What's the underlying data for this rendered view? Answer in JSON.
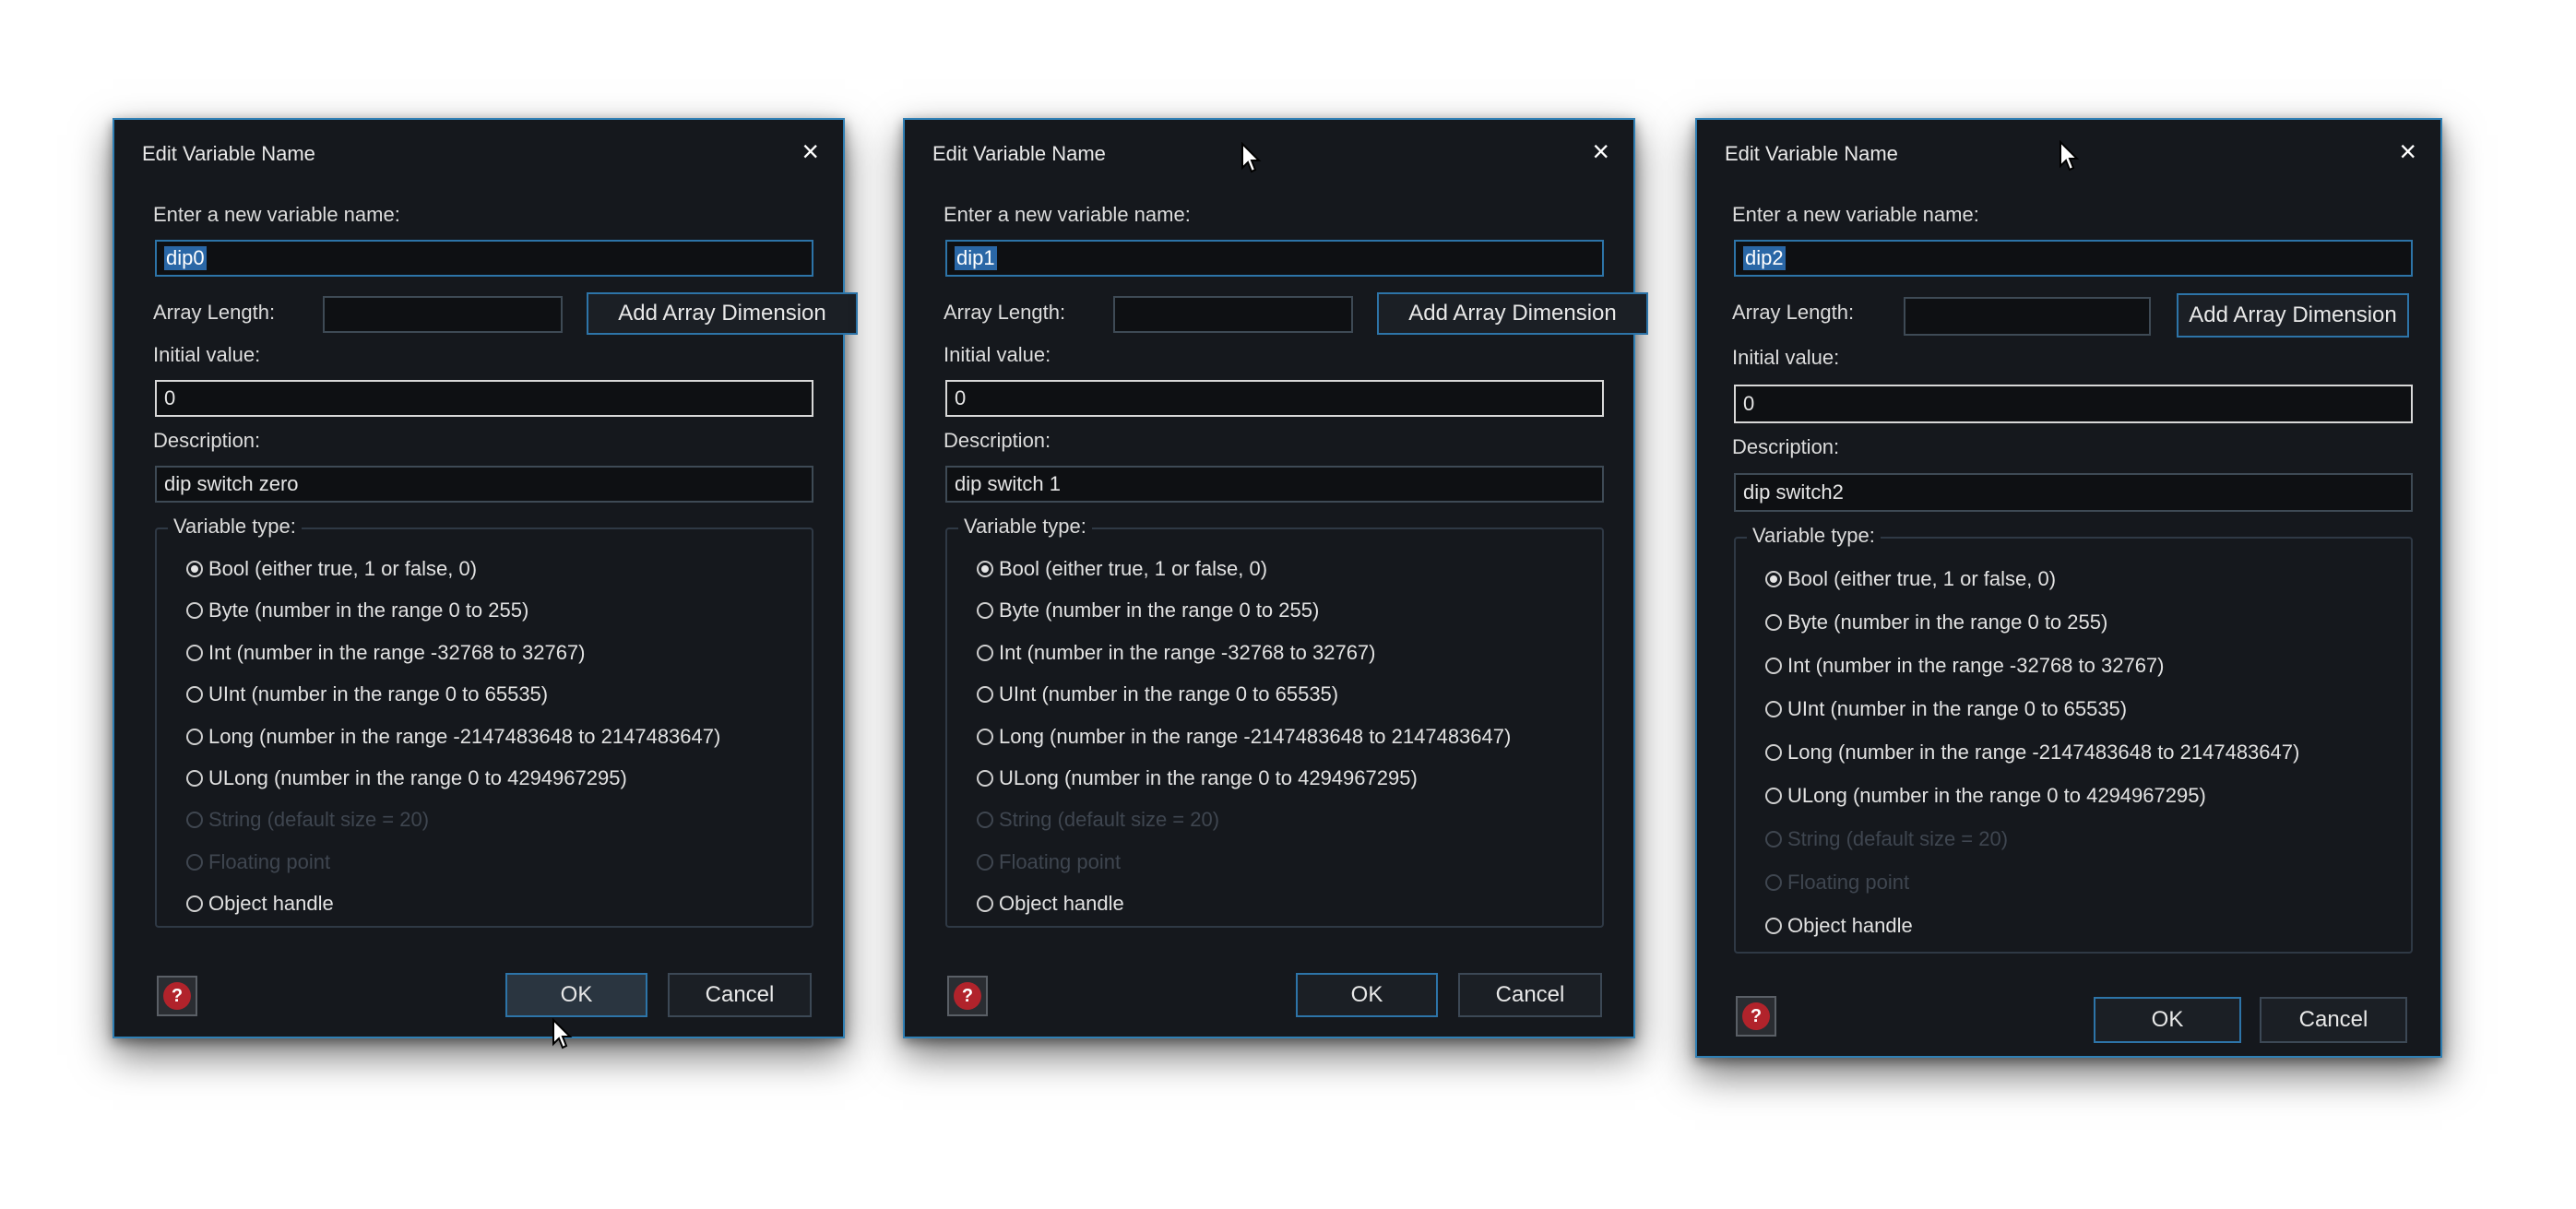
{
  "dialogs": [
    {
      "title": "Edit Variable Name",
      "name_label": "Enter a new variable name:",
      "name_value": "dip0",
      "array_length_label": "Array Length:",
      "array_length_value": "",
      "add_array_dimension_label": "Add Array Dimension",
      "initial_value_label": "Initial value:",
      "initial_value": "0",
      "description_label": "Description:",
      "description_value": "dip switch zero",
      "variable_type_label": "Variable type:",
      "selected_type": "Bool",
      "types": [
        {
          "label": "Bool (either true, 1 or false, 0)",
          "enabled": true,
          "checked": true
        },
        {
          "label": "Byte (number in the range 0 to 255)",
          "enabled": true,
          "checked": false
        },
        {
          "label": "Int (number in the range -32768 to 32767)",
          "enabled": true,
          "checked": false
        },
        {
          "label": "UInt (number in the range 0 to 65535)",
          "enabled": true,
          "checked": false
        },
        {
          "label": "Long (number in the range -2147483648 to 2147483647)",
          "enabled": true,
          "checked": false
        },
        {
          "label": "ULong (number in the range 0 to 4294967295)",
          "enabled": true,
          "checked": false
        },
        {
          "label": "String (default size = 20)",
          "enabled": false,
          "checked": false
        },
        {
          "label": "Floating point",
          "enabled": false,
          "checked": false
        },
        {
          "label": "Object handle",
          "enabled": true,
          "checked": false
        }
      ],
      "ok_label": "OK",
      "cancel_label": "Cancel"
    },
    {
      "title": "Edit Variable Name",
      "name_label": "Enter a new variable name:",
      "name_value": "dip1",
      "array_length_label": "Array Length:",
      "array_length_value": "",
      "add_array_dimension_label": "Add Array Dimension",
      "initial_value_label": "Initial value:",
      "initial_value": "0",
      "description_label": "Description:",
      "description_value": "dip switch 1",
      "variable_type_label": "Variable type:",
      "selected_type": "Bool",
      "types": [
        {
          "label": "Bool (either true, 1 or false, 0)",
          "enabled": true,
          "checked": true
        },
        {
          "label": "Byte (number in the range 0 to 255)",
          "enabled": true,
          "checked": false
        },
        {
          "label": "Int (number in the range -32768 to 32767)",
          "enabled": true,
          "checked": false
        },
        {
          "label": "UInt (number in the range 0 to 65535)",
          "enabled": true,
          "checked": false
        },
        {
          "label": "Long (number in the range -2147483648 to 2147483647)",
          "enabled": true,
          "checked": false
        },
        {
          "label": "ULong (number in the range 0 to 4294967295)",
          "enabled": true,
          "checked": false
        },
        {
          "label": "String (default size = 20)",
          "enabled": false,
          "checked": false
        },
        {
          "label": "Floating point",
          "enabled": false,
          "checked": false
        },
        {
          "label": "Object handle",
          "enabled": true,
          "checked": false
        }
      ],
      "ok_label": "OK",
      "cancel_label": "Cancel"
    },
    {
      "title": "Edit Variable Name",
      "name_label": "Enter a new variable name:",
      "name_value": "dip2",
      "array_length_label": "Array Length:",
      "array_length_value": "",
      "add_array_dimension_label": "Add Array Dimension",
      "initial_value_label": "Initial value:",
      "initial_value": "0",
      "description_label": "Description:",
      "description_value": "dip switch2",
      "variable_type_label": "Variable type:",
      "selected_type": "Bool",
      "types": [
        {
          "label": "Bool (either true, 1 or false, 0)",
          "enabled": true,
          "checked": true
        },
        {
          "label": "Byte (number in the range 0 to 255)",
          "enabled": true,
          "checked": false
        },
        {
          "label": "Int (number in the range -32768 to 32767)",
          "enabled": true,
          "checked": false
        },
        {
          "label": "UInt (number in the range 0 to 65535)",
          "enabled": true,
          "checked": false
        },
        {
          "label": "Long (number in the range -2147483648 to 2147483647)",
          "enabled": true,
          "checked": false
        },
        {
          "label": "ULong (number in the range 0 to 4294967295)",
          "enabled": true,
          "checked": false
        },
        {
          "label": "String (default size = 20)",
          "enabled": false,
          "checked": false
        },
        {
          "label": "Floating point",
          "enabled": false,
          "checked": false
        },
        {
          "label": "Object handle",
          "enabled": true,
          "checked": false
        }
      ],
      "ok_label": "OK",
      "cancel_label": "Cancel"
    }
  ],
  "icons": {
    "close": "close-icon",
    "help": "help-icon",
    "help_glyph": "?",
    "close_glyph": "×",
    "cursor": "mouse-cursor-icon"
  },
  "colors": {
    "dialog_background": "#15181d",
    "dialog_border": "#2f7fb4",
    "selection": "#2a67a6",
    "help_red": "#b1232b"
  }
}
